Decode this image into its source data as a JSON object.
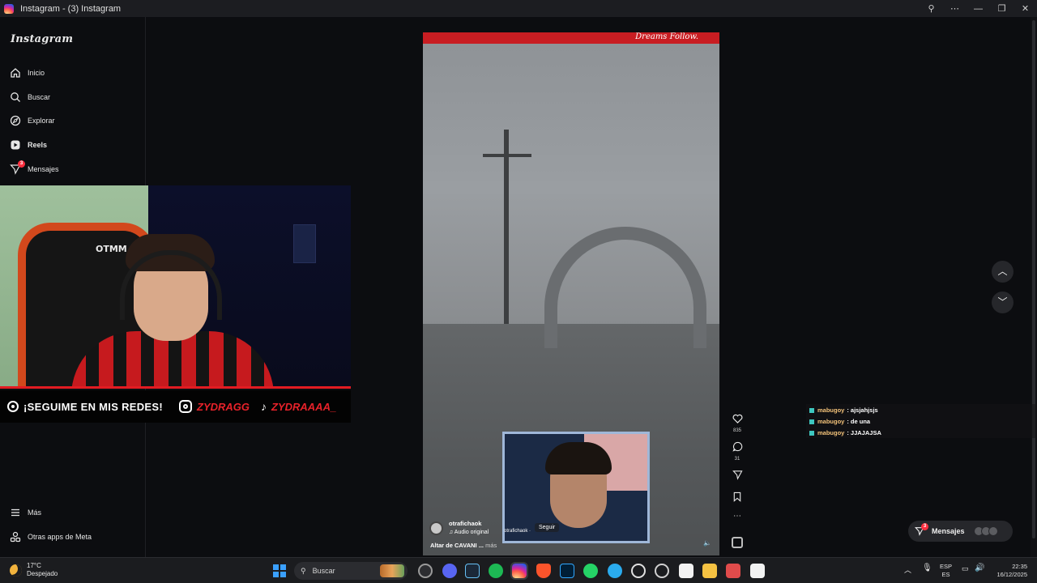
{
  "window": {
    "title": "Instagram - (3) Instagram",
    "controls": [
      "zoom-icon",
      "more-icon",
      "minimize-icon",
      "maximize-icon",
      "close-icon"
    ]
  },
  "sidebar": {
    "brand": "Instagram",
    "items": [
      {
        "label": "Inicio",
        "icon": "home-icon"
      },
      {
        "label": "Buscar",
        "icon": "search-icon"
      },
      {
        "label": "Explorar",
        "icon": "compass-icon"
      },
      {
        "label": "Reels",
        "icon": "reels-icon",
        "active": true
      },
      {
        "label": "Mensajes",
        "icon": "messenger-icon",
        "badge": "3"
      }
    ],
    "bottom": [
      {
        "label": "Más",
        "icon": "menu-icon"
      },
      {
        "label": "Otras apps de Meta",
        "icon": "meta-apps-icon"
      }
    ]
  },
  "stream_overlay": {
    "chair_logo": "OTMM",
    "banner_text": "¡SEGUIME EN MIS REDES!",
    "instagram_handle": "ZYDRAGG",
    "tiktok_handle": "ZYDRAAAA_",
    "accent": "#e8222a"
  },
  "reel": {
    "top_text": "Dreams Follow.",
    "author": "otrafichaok",
    "audio": "♫ Audio original",
    "inner_tag": "otrafichaok · ",
    "follow_label": "Seguir",
    "caption": "Altar de CAVANI ... ",
    "caption_more": "más",
    "likes": "835",
    "comments": "31"
  },
  "chat": [
    {
      "user": "mabugoy",
      "message": ": ajsjahjsjs"
    },
    {
      "user": "mabugoy",
      "message": ": de una"
    },
    {
      "user": "mabugoy",
      "message": ": JJAJAJSA"
    }
  ],
  "messages_pill": {
    "label": "Mensajes",
    "badge": "3"
  },
  "taskbar": {
    "temperature": "17°C",
    "condition": "Despejado",
    "search_placeholder": "Buscar",
    "lang_top": "ESP",
    "lang_bottom": "ES",
    "time": "22:35",
    "date": "16/12/2025"
  }
}
